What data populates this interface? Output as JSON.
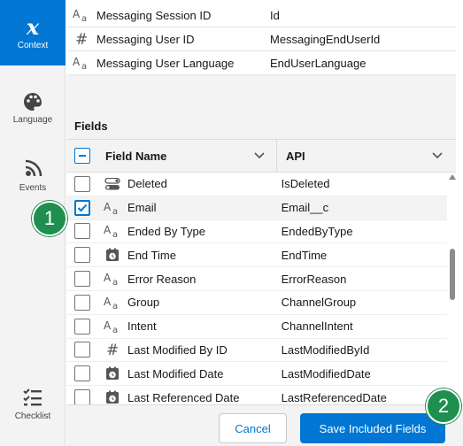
{
  "rail": {
    "items": [
      {
        "label": "Context",
        "icon": "x-context-icon",
        "active": true
      },
      {
        "label": "Language",
        "icon": "palette-icon"
      },
      {
        "label": "Events",
        "icon": "signal-icon"
      },
      {
        "label": "Checklist",
        "icon": "checklist-icon"
      }
    ]
  },
  "context_rows": [
    {
      "type": "text",
      "name": "Messaging Session ID",
      "api": "Id"
    },
    {
      "type": "number",
      "name": "Messaging User ID",
      "api": "MessagingEndUserId"
    },
    {
      "type": "text",
      "name": "Messaging User Language",
      "api": "EndUserLanguage"
    }
  ],
  "fields": {
    "title": "Fields",
    "col_field_name": "Field Name",
    "col_api": "API",
    "rows": [
      {
        "type": "toggle",
        "name": "Deleted",
        "api": "IsDeleted",
        "checked": false
      },
      {
        "type": "text",
        "name": "Email",
        "api": "Email__c",
        "checked": true
      },
      {
        "type": "text",
        "name": "Ended By Type",
        "api": "EndedByType",
        "checked": false
      },
      {
        "type": "datetime",
        "name": "End Time",
        "api": "EndTime",
        "checked": false
      },
      {
        "type": "text",
        "name": "Error Reason",
        "api": "ErrorReason",
        "checked": false
      },
      {
        "type": "text",
        "name": "Group",
        "api": "ChannelGroup",
        "checked": false
      },
      {
        "type": "text",
        "name": "Intent",
        "api": "ChannelIntent",
        "checked": false
      },
      {
        "type": "number",
        "name": "Last Modified By ID",
        "api": "LastModifiedById",
        "checked": false
      },
      {
        "type": "datetime",
        "name": "Last Modified Date",
        "api": "LastModifiedDate",
        "checked": false
      },
      {
        "type": "datetime",
        "name": "Last Referenced Date",
        "api": "LastReferencedDate",
        "checked": false
      }
    ]
  },
  "footer": {
    "cancel_label": "Cancel",
    "save_label": "Save Included Fields"
  },
  "badges": {
    "one": "1",
    "two": "2"
  },
  "colors": {
    "brand": "#0176d3",
    "badge": "#1e8f4e"
  }
}
